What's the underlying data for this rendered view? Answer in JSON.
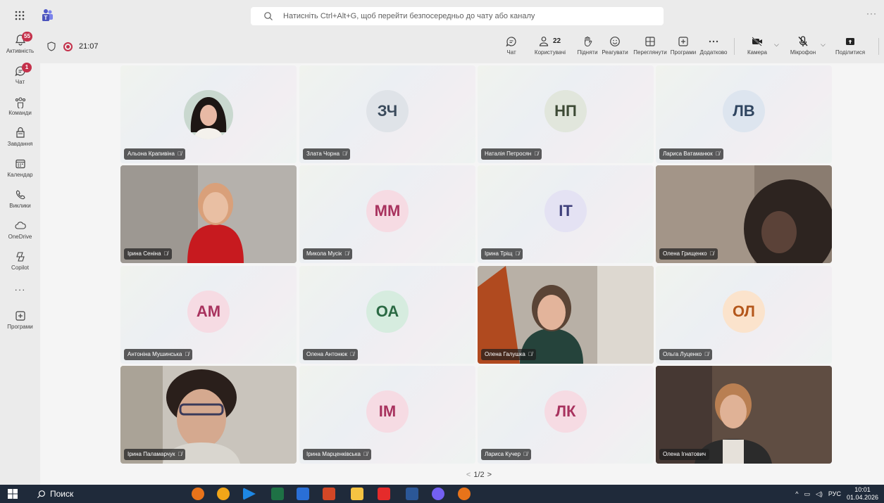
{
  "titlebar": {
    "search_placeholder": "Натисніть Ctrl+Alt+G, щоб перейти безпосередньо до чату або каналу"
  },
  "rail": {
    "items": [
      {
        "label": "Активність",
        "icon": "bell-icon",
        "badge": "55"
      },
      {
        "label": "Чат",
        "icon": "chat-icon",
        "badge": "1"
      },
      {
        "label": "Команди",
        "icon": "teams-icon",
        "badge": ""
      },
      {
        "label": "Завдання",
        "icon": "tasks-icon",
        "badge": ""
      },
      {
        "label": "Календар",
        "icon": "calendar-icon",
        "badge": ""
      },
      {
        "label": "Виклики",
        "icon": "phone-icon",
        "badge": ""
      },
      {
        "label": "OneDrive",
        "icon": "cloud-icon",
        "badge": ""
      },
      {
        "label": "Copilot",
        "icon": "copilot-icon",
        "badge": ""
      },
      {
        "label": "Програми",
        "icon": "apps-icon",
        "badge": ""
      }
    ]
  },
  "meeting": {
    "timer": "21:07",
    "tools": {
      "chat": "Чат",
      "people": "Користувачі",
      "people_count": "22",
      "raise": "Підняти",
      "react": "Реагувати",
      "view": "Переглянути",
      "apps": "Програми",
      "more": "Додатково",
      "camera": "Камера",
      "mic": "Мікрофон",
      "share": "Поділитися"
    }
  },
  "participants": [
    {
      "name": "Альона Крапивіна",
      "initials": "",
      "type": "photo",
      "bg": "#f3f0ee",
      "fg": ""
    },
    {
      "name": "Злата Чорна",
      "initials": "ЗЧ",
      "type": "initials",
      "bg": "#dfe3e8",
      "fg": "#3b4b5c"
    },
    {
      "name": "Наталія Петросян",
      "initials": "НП",
      "type": "initials",
      "bg": "#e1e6dc",
      "fg": "#3d4a35"
    },
    {
      "name": "Лариса Ватаманюк",
      "initials": "ЛВ",
      "type": "initials",
      "bg": "#dde5ef",
      "fg": "#2f4560"
    },
    {
      "name": "Ірина Сеніна",
      "initials": "",
      "type": "video",
      "bg": "#b9b3ae",
      "fg": ""
    },
    {
      "name": "Микола Мусік",
      "initials": "ММ",
      "type": "initials",
      "bg": "#f6dbe3",
      "fg": "#a8325e"
    },
    {
      "name": "Ірина Тріщ",
      "initials": "ІТ",
      "type": "initials",
      "bg": "#e4e2f3",
      "fg": "#3e3f7a"
    },
    {
      "name": "Олена Грищенко",
      "initials": "",
      "type": "video",
      "bg": "#8c7b6e",
      "fg": ""
    },
    {
      "name": "Антоніна Мушинська",
      "initials": "АМ",
      "type": "initials",
      "bg": "#f6dbe3",
      "fg": "#a8325e"
    },
    {
      "name": "Олена Антонюк",
      "initials": "ОА",
      "type": "initials",
      "bg": "#d6ecdf",
      "fg": "#2b6a44"
    },
    {
      "name": "Олена Галушка",
      "initials": "",
      "type": "video",
      "bg": "#a49b92",
      "fg": ""
    },
    {
      "name": "Ольга Луценко",
      "initials": "ОЛ",
      "type": "initials",
      "bg": "#fbe3cc",
      "fg": "#b4571b"
    },
    {
      "name": "Ірина Паламарчук",
      "initials": "",
      "type": "video",
      "bg": "#c7c3bd",
      "fg": ""
    },
    {
      "name": "Ірина Марценківська",
      "initials": "ІМ",
      "type": "initials",
      "bg": "#f6dbe3",
      "fg": "#a8325e"
    },
    {
      "name": "Лариса Кучер",
      "initials": "ЛК",
      "type": "initials",
      "bg": "#f6dbe3",
      "fg": "#a8325e"
    },
    {
      "name": "Олена Ігнатович",
      "initials": "",
      "type": "video",
      "bg": "#6f5e52",
      "fg": ""
    }
  ],
  "pager": {
    "text": "1/2"
  },
  "taskbar": {
    "search_label": "Поиск",
    "lang": "РУС",
    "time": "10:01",
    "date": "01.04.2026"
  }
}
